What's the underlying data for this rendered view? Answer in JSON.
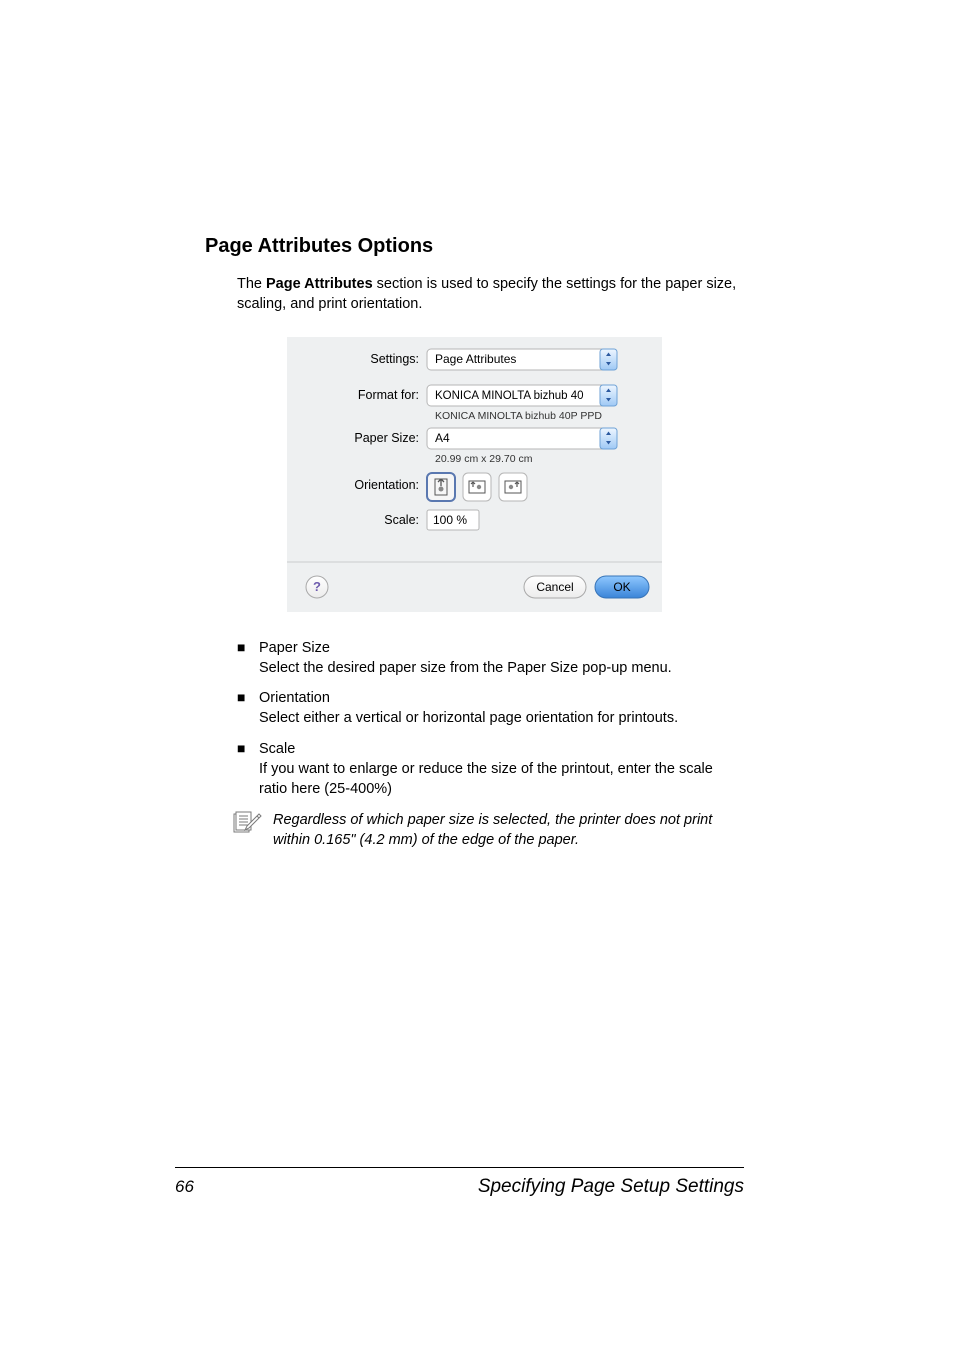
{
  "heading": "Page Attributes Options",
  "intro_pre": "The ",
  "intro_bold": "Page Attributes",
  "intro_post": " section is used to specify the settings for the paper size, scaling, and print orientation.",
  "dialog": {
    "settings_label": "Settings:",
    "settings_value": "Page Attributes",
    "formatfor_label": "Format for:",
    "formatfor_value": "KONICA MINOLTA bizhub 40",
    "formatfor_sub": "KONICA MINOLTA bizhub 40P PPD",
    "papersize_label": "Paper Size:",
    "papersize_value": "A4",
    "papersize_sub": "20.99 cm x 29.70 cm",
    "orientation_label": "Orientation:",
    "scale_label": "Scale:",
    "scale_value": "100 %",
    "cancel": "Cancel",
    "ok": "OK"
  },
  "bullets": [
    {
      "title": "Paper Size",
      "desc": "Select the desired paper size from the Paper Size pop-up menu."
    },
    {
      "title": "Orientation",
      "desc": "Select either a vertical or horizontal page orientation for printouts."
    },
    {
      "title": "Scale",
      "desc": "If you want to enlarge or reduce the size of the printout, enter the scale ratio here (25-400%)"
    }
  ],
  "note": "Regardless of which paper size is selected, the printer does not print within 0.165\" (4.2 mm) of the edge of the paper.",
  "footer_page": "66",
  "footer_title": "Specifying Page Setup Settings"
}
